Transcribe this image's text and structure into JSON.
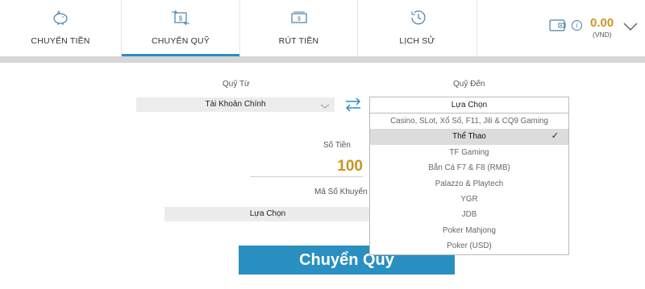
{
  "nav": {
    "tabs": [
      {
        "label": "CHUYỂN TIỀN",
        "icon": "piggy-bank-icon"
      },
      {
        "label": "CHUYỂN QUỸ",
        "icon": "transfer-money-icon",
        "active": true
      },
      {
        "label": "RÚT TIỀN",
        "icon": "withdraw-money-icon"
      },
      {
        "label": "LỊCH SỬ",
        "icon": "history-clock-icon"
      }
    ]
  },
  "wallet": {
    "amount": "0.00",
    "currency": "(VND)",
    "info": "i"
  },
  "form": {
    "from_label": "Quỹ Từ",
    "from_value": "Tài Khoản Chính",
    "to_label": "Quỹ Đến",
    "to_selected": "Lựa Chọn",
    "to_options": [
      "Casino, SLot, Xổ Số, F11, Jili & CQ9 Gaming",
      "Thể Thao",
      "TF Gaming",
      "Bắn Cá F7 & F8 (RMB)",
      "Palazzo & Playtech",
      "YGR",
      "JDB",
      "Poker Mahjong",
      "Poker (USD)"
    ],
    "highlighted_option": "Thể Thao",
    "check_mark": "✓",
    "amount_label": "Số Tiền",
    "amount_value": "100",
    "promo_label": "Mã Số Khuyến M",
    "promo_value": "Lựa Chọn",
    "submit_label": "Chuyển Quỹ"
  },
  "colors": {
    "accent": "#2a8fc1",
    "amount": "#c8961e"
  }
}
